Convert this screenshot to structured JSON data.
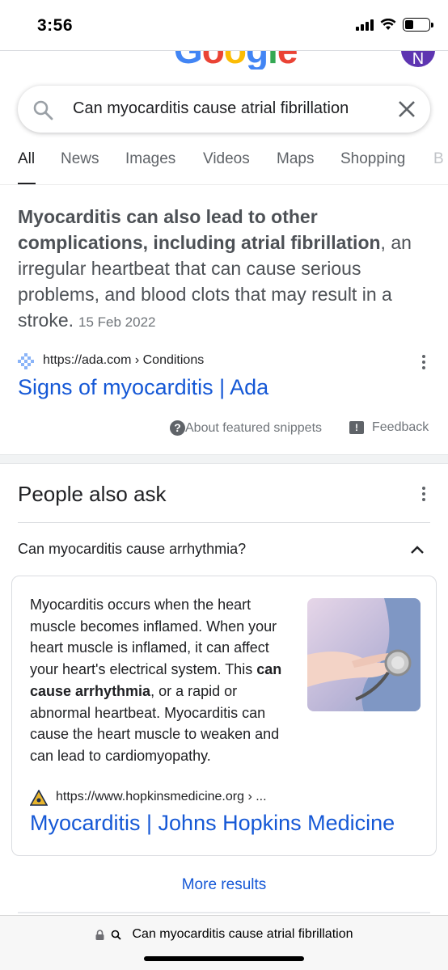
{
  "status_bar": {
    "time": "3:56",
    "battery_level": 0.35
  },
  "header": {
    "logo_letters": [
      "G",
      "o",
      "o",
      "g",
      "l",
      "e"
    ],
    "avatar_initial": "N"
  },
  "search": {
    "query": "Can myocarditis cause atrial fibrillation"
  },
  "tabs": [
    "All",
    "News",
    "Images",
    "Videos",
    "Maps",
    "Shopping",
    "B"
  ],
  "featured_snippet": {
    "bold_text": "Myocarditis can also lead to other complications, including atrial fibrillation",
    "rest_text": ", an irregular heartbeat that can cause serious problems, and blood clots that may result in a stroke.",
    "date": "15 Feb 2022",
    "source_url": "https://ada.com › Conditions",
    "title": "Signs of myocarditis | Ada",
    "about_label": "About featured snippets",
    "feedback_label": "Feedback"
  },
  "people_also_ask": {
    "heading": "People also ask",
    "question": "Can myocarditis cause arrhythmia?",
    "answer_before": "Myocarditis occurs when the heart muscle becomes inflamed. When your heart muscle is inflamed, it can affect your heart's electrical system. This ",
    "answer_bold": "can cause arrhythmia",
    "answer_after": ", or a rapid or abnormal heartbeat. Myocarditis can cause the heart muscle to weaken and can lead to cardiomyopathy.",
    "source_url": "https://www.hopkinsmedicine.org › ...",
    "source_title": "Myocarditis | Johns Hopkins Medicine"
  },
  "more_results_label": "More results",
  "address_bar": {
    "url_text": "Can myocarditis cause atrial fibrillation"
  },
  "colors": {
    "link": "#1558d6",
    "google_blue": "#4285f4",
    "google_red": "#ea4335",
    "google_yellow": "#fbbc05",
    "google_green": "#34a853",
    "avatar": "#5e35b1"
  }
}
